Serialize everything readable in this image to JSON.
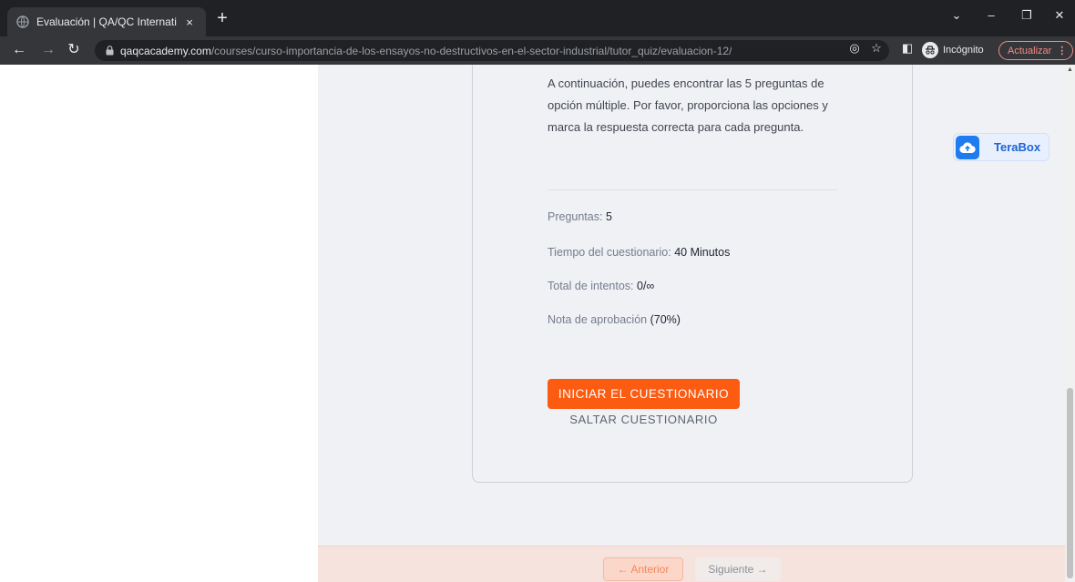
{
  "browser": {
    "tab_title": "Evaluación | QA/QC International",
    "tab_close": "×",
    "new_tab": "+",
    "url_host": "qaqcacademy.com",
    "url_path": "/courses/curso-importancia-de-los-ensayos-no-destructivos-en-el-sector-industrial/tutor_quiz/evaluacion-12/",
    "incognito_label": "Incógnito",
    "update_label": "Actualizar"
  },
  "quiz": {
    "intro": "A continuación, puedes encontrar las 5 preguntas de opción múltiple. Por favor, proporciona las opciones y marca la respuesta correcta para cada pregunta.",
    "questions_label": "Preguntas:",
    "questions_value": "5",
    "time_label": "Tiempo del cuestionario:",
    "time_value": "40 Minutos",
    "attempts_label": "Total de intentos:",
    "attempts_value": "0/∞",
    "pass_label": "Nota de aprobación",
    "pass_value": "(70%)",
    "start_button": "INICIAR EL CUESTIONARIO",
    "skip_button": "SALTAR CUESTIONARIO"
  },
  "footer": {
    "prev_label": "← Anterior",
    "next_label": "Siguiente →"
  },
  "widget": {
    "terabox_label": "TeraBox"
  },
  "colors": {
    "accent": "#fc5b12",
    "footer_bg": "#f6e3dd",
    "terabox_blue": "#1e7cf0"
  }
}
